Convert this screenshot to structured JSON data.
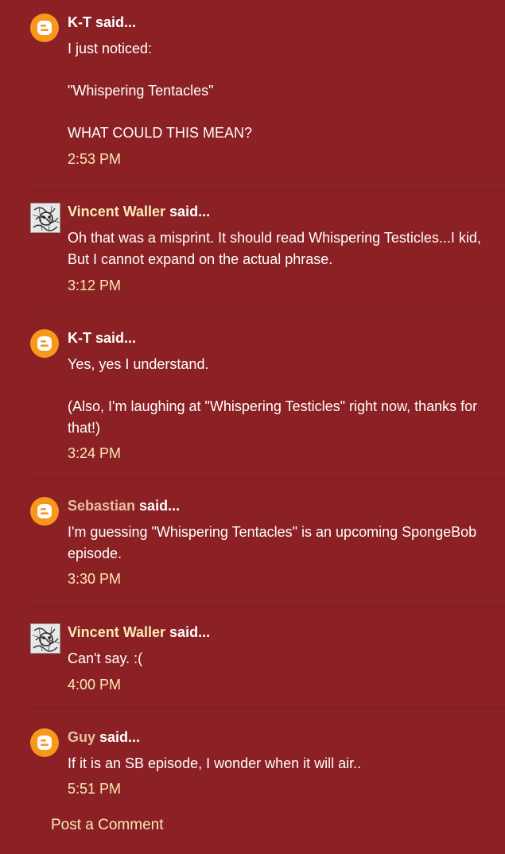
{
  "said_suffix": " said...",
  "comments": [
    {
      "author": "K-T",
      "avatar": "blogger-icon",
      "lines": [
        "I just noticed:",
        "\"Whispering Tentacles\"",
        "WHAT COULD THIS MEAN?"
      ],
      "time": "2:53 PM"
    },
    {
      "author": "Vincent Waller",
      "avatar": "sketch-avatar",
      "lines": [
        "Oh that was a misprint. It should read Whispering Testicles...I kid, But I cannot expand on the actual phrase."
      ],
      "time": "3:12 PM"
    },
    {
      "author": "K-T",
      "avatar": "blogger-icon",
      "lines": [
        "Yes, yes I understand.",
        "(Also, I'm laughing at \"Whispering Testicles\" right now, thanks for that!)"
      ],
      "time": "3:24 PM"
    },
    {
      "author": "Sebastian",
      "avatar": "blogger-icon",
      "lines": [
        "I'm guessing \"Whispering Tentacles\" is an upcoming SpongeBob episode."
      ],
      "time": "3:30 PM"
    },
    {
      "author": "Vincent Waller",
      "avatar": "sketch-avatar",
      "lines": [
        "Can't say. :("
      ],
      "time": "4:00 PM"
    },
    {
      "author": "Guy",
      "avatar": "blogger-icon",
      "lines": [
        "If it is an SB episode, I wonder when it will air.."
      ],
      "time": "5:51 PM"
    }
  ],
  "post_comment_label": "Post a Comment",
  "colors": {
    "background": "#8b2124",
    "link": "#fbeab5",
    "text": "#ffffff",
    "blogger_orange": "#f8971c"
  }
}
